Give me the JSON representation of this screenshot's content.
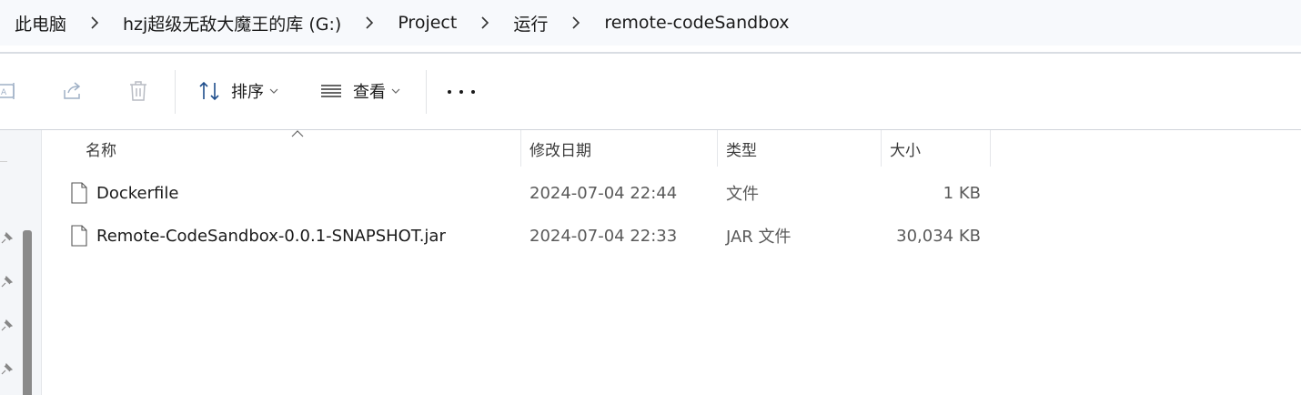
{
  "breadcrumb": {
    "items": [
      "此电脑",
      "hzj超级无敌大魔王的库 (G:)",
      "Project",
      "运行",
      "remote-codeSandbox"
    ]
  },
  "toolbar": {
    "icons": [
      "rename-icon",
      "share-icon",
      "delete-icon"
    ],
    "sort_label": "排序",
    "view_label": "查看",
    "more_icon": "more-icon"
  },
  "columns": {
    "name": "名称",
    "modified": "修改日期",
    "type": "类型",
    "size": "大小"
  },
  "files": [
    {
      "name": "Dockerfile",
      "modified": "2024-07-04 22:44",
      "type": "文件",
      "size": "1 KB"
    },
    {
      "name": "Remote-CodeSandbox-0.0.1-SNAPSHOT.jar",
      "modified": "2024-07-04 22:33",
      "type": "JAR 文件",
      "size": "30,034 KB"
    }
  ],
  "colors": {
    "breadcrumb_bg": "#f7f9fc",
    "nav_bg": "#f4f6f9",
    "secondary_text": "#5a5a5a"
  }
}
